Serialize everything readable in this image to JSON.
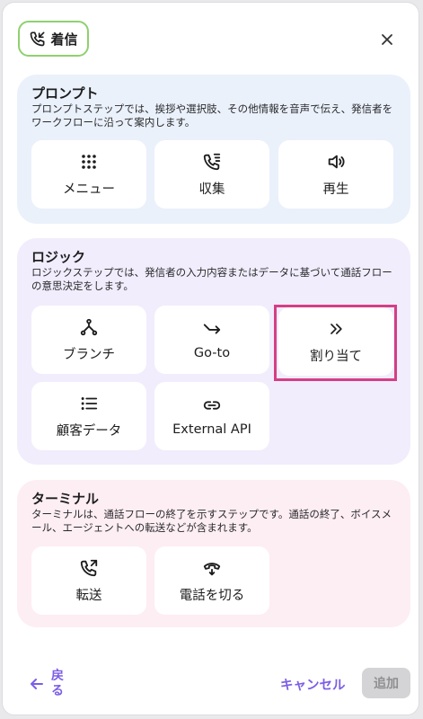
{
  "header": {
    "chip_label": "着信",
    "chip_icon": "phone-incoming-icon",
    "close_icon": "close-icon"
  },
  "sections": {
    "prompt": {
      "title": "プロンプト",
      "description": "プロンプトステップでは、挨拶や選択肢、その他情報を音声で伝え、発信者をワークフローに沿って案内します。",
      "items": [
        {
          "label": "メニュー",
          "icon": "grid-dots-icon"
        },
        {
          "label": "収集",
          "icon": "phone-collect-icon"
        },
        {
          "label": "再生",
          "icon": "speaker-icon"
        }
      ]
    },
    "logic": {
      "title": "ロジック",
      "description": "ロジックステップでは、発信者の入力内容またはデータに基づいて通話フローの意思決定をします。",
      "items": [
        {
          "label": "ブランチ",
          "icon": "branch-icon"
        },
        {
          "label": "Go-to",
          "icon": "goto-arrow-icon"
        },
        {
          "label": "割り当て",
          "icon": "double-chevron-right-icon"
        },
        {
          "label": "顧客データ",
          "icon": "list-icon"
        },
        {
          "label": "External API",
          "icon": "link-icon"
        }
      ]
    },
    "terminal": {
      "title": "ターミナル",
      "description": "ターミナルは、通話フローの終了を示すステップです。通話の終了、ボイスメール、エージェントへの転送などが含まれます。",
      "items": [
        {
          "label": "転送",
          "icon": "phone-transfer-icon"
        },
        {
          "label": "電話を切る",
          "icon": "phone-hangup-icon"
        }
      ]
    }
  },
  "footer": {
    "back_label": "戻る",
    "cancel_label": "キャンセル",
    "add_label": "追加"
  },
  "colors": {
    "accent": "#7c5ee6",
    "highlight": "#d43f86",
    "chip_border": "#8fd06f"
  }
}
